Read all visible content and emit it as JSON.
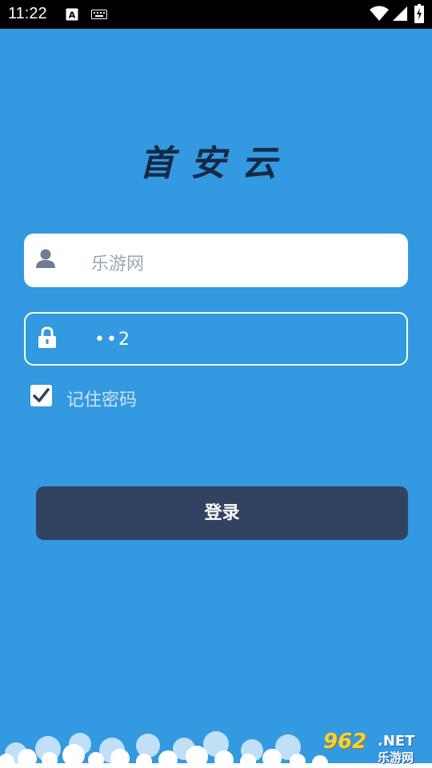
{
  "status_bar": {
    "time": "11:22",
    "icons": [
      "a-font-icon",
      "keyboard-icon",
      "wifi-icon",
      "signal-icon",
      "battery-charging-icon"
    ]
  },
  "app": {
    "title": "首安云"
  },
  "login_form": {
    "username_value": "乐游网",
    "password_value": "••2",
    "remember_label": "记住密码",
    "remember_checked": true,
    "login_button_label": "登录"
  },
  "watermark": {
    "number": "962",
    "suffix": ".NET",
    "site_name": "乐游网"
  },
  "colors": {
    "background": "#3399e0",
    "button": "#324361",
    "title": "#152946"
  }
}
